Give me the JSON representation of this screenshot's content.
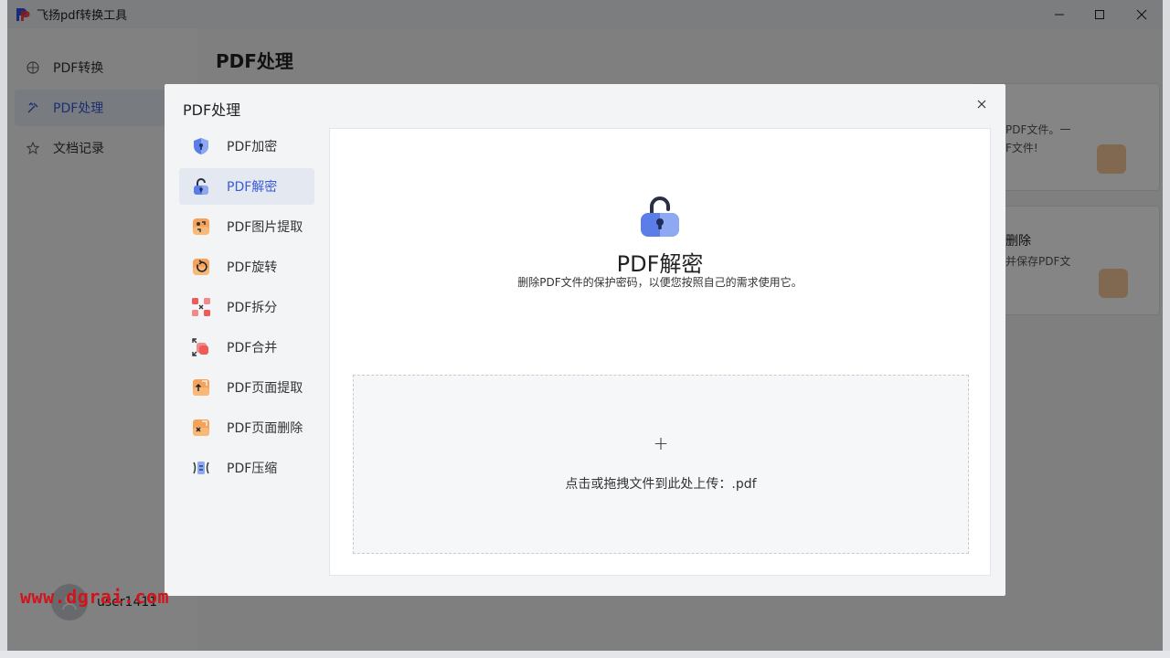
{
  "window": {
    "title": "飞扬pdf转换工具",
    "controls": {
      "minimize": "—",
      "maximize": "☐",
      "close": "✕"
    }
  },
  "sidebar": {
    "items": [
      {
        "label": "PDF转换",
        "icon": "grid-icon",
        "active": false
      },
      {
        "label": "PDF处理",
        "icon": "tools-icon",
        "active": true
      },
      {
        "label": "文档记录",
        "icon": "star-icon",
        "active": false
      }
    ],
    "username": "user1411"
  },
  "watermark": "www.dgrai.com",
  "main": {
    "title": "PDF处理",
    "bg_cards": [
      {
        "line1": "PDF文件。一",
        "line2": "F文件!"
      },
      {
        "line1": "删除",
        "line2": "并保存PDF文"
      }
    ]
  },
  "modal": {
    "title": "PDF处理",
    "close": "×",
    "menu": [
      {
        "label": "PDF加密",
        "icon": "shield-icon",
        "active": false
      },
      {
        "label": "PDF解密",
        "icon": "unlock-icon",
        "active": true
      },
      {
        "label": "PDF图片提取",
        "icon": "image-extract-icon",
        "active": false
      },
      {
        "label": "PDF旋转",
        "icon": "rotate-icon",
        "active": false
      },
      {
        "label": "PDF拆分",
        "icon": "split-icon",
        "active": false
      },
      {
        "label": "PDF合并",
        "icon": "merge-icon",
        "active": false
      },
      {
        "label": "PDF页面提取",
        "icon": "page-extract-icon",
        "active": false
      },
      {
        "label": "PDF页面删除",
        "icon": "page-delete-icon",
        "active": false
      },
      {
        "label": "PDF压缩",
        "icon": "compress-icon",
        "active": false
      }
    ],
    "panel": {
      "heading": "PDF解密",
      "description": "删除PDF文件的保护密码，以便您按照自己的需求使用它。",
      "upload_plus": "+",
      "upload_text": "点击或拖拽文件到此处上传：.pdf"
    }
  },
  "colors": {
    "accent": "#3a5bd6",
    "icon_orange": "#f5a25c",
    "icon_red": "#ee5b5b",
    "icon_blue": "#5b7de8"
  }
}
